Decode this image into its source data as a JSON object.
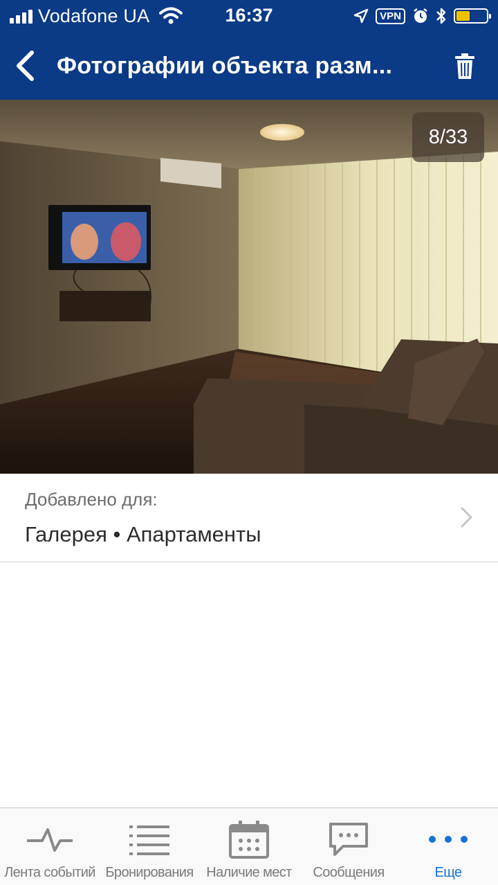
{
  "status_bar": {
    "carrier": "Vodafone UA",
    "time": "16:37",
    "vpn": "VPN",
    "battery_level": 0.45,
    "battery_color": "#f2c200"
  },
  "nav": {
    "title": "Фотографии объекта разм...",
    "back_icon": "chevron-left-icon",
    "delete_icon": "trash-icon"
  },
  "photo": {
    "counter": "8/33"
  },
  "added": {
    "label": "Добавлено для:",
    "value": "Галерея • Апартаменты"
  },
  "tabs": [
    {
      "label": "Лента событий",
      "icon": "activity-icon",
      "active": false
    },
    {
      "label": "Бронирования",
      "icon": "list-icon",
      "active": false
    },
    {
      "label": "Наличие мест",
      "icon": "calendar-icon",
      "active": false
    },
    {
      "label": "Сообщения",
      "icon": "message-icon",
      "active": false
    },
    {
      "label": "Еще",
      "icon": "more-icon",
      "active": true
    }
  ],
  "colors": {
    "header_bg": "#0b3a86",
    "tab_active": "#1372d6",
    "tab_inactive": "#7a7a7a"
  }
}
